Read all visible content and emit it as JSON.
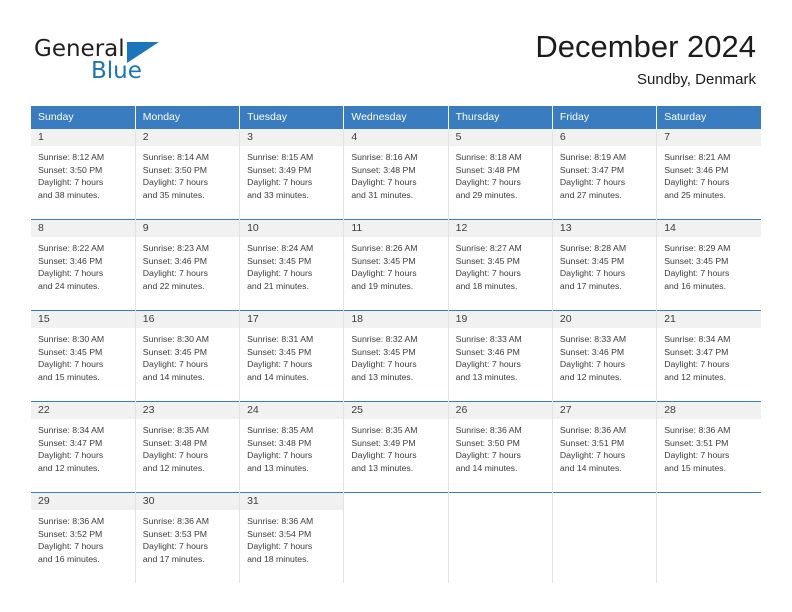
{
  "brand": {
    "name_part1": "General",
    "name_part2": "Blue",
    "triangle_icon": "triangle-icon",
    "accent_color": "#1b75bc"
  },
  "header": {
    "title": "December 2024",
    "subtitle": "Sundby, Denmark"
  },
  "colors": {
    "header_blue": "#3a7cc0",
    "daynum_bg": "#f1f1f1",
    "text": "#3c3c3c"
  },
  "weekday_headers": [
    "Sunday",
    "Monday",
    "Tuesday",
    "Wednesday",
    "Thursday",
    "Friday",
    "Saturday"
  ],
  "labels": {
    "sunrise_prefix": "Sunrise:",
    "sunset_prefix": "Sunset:",
    "daylight_prefix": "Daylight:"
  },
  "weeks": [
    [
      {
        "day": "1",
        "sunrise": "Sunrise: 8:12 AM",
        "sunset": "Sunset: 3:50 PM",
        "daylight1": "Daylight: 7 hours",
        "daylight2": "and 38 minutes."
      },
      {
        "day": "2",
        "sunrise": "Sunrise: 8:14 AM",
        "sunset": "Sunset: 3:50 PM",
        "daylight1": "Daylight: 7 hours",
        "daylight2": "and 35 minutes."
      },
      {
        "day": "3",
        "sunrise": "Sunrise: 8:15 AM",
        "sunset": "Sunset: 3:49 PM",
        "daylight1": "Daylight: 7 hours",
        "daylight2": "and 33 minutes."
      },
      {
        "day": "4",
        "sunrise": "Sunrise: 8:16 AM",
        "sunset": "Sunset: 3:48 PM",
        "daylight1": "Daylight: 7 hours",
        "daylight2": "and 31 minutes."
      },
      {
        "day": "5",
        "sunrise": "Sunrise: 8:18 AM",
        "sunset": "Sunset: 3:48 PM",
        "daylight1": "Daylight: 7 hours",
        "daylight2": "and 29 minutes."
      },
      {
        "day": "6",
        "sunrise": "Sunrise: 8:19 AM",
        "sunset": "Sunset: 3:47 PM",
        "daylight1": "Daylight: 7 hours",
        "daylight2": "and 27 minutes."
      },
      {
        "day": "7",
        "sunrise": "Sunrise: 8:21 AM",
        "sunset": "Sunset: 3:46 PM",
        "daylight1": "Daylight: 7 hours",
        "daylight2": "and 25 minutes."
      }
    ],
    [
      {
        "day": "8",
        "sunrise": "Sunrise: 8:22 AM",
        "sunset": "Sunset: 3:46 PM",
        "daylight1": "Daylight: 7 hours",
        "daylight2": "and 24 minutes."
      },
      {
        "day": "9",
        "sunrise": "Sunrise: 8:23 AM",
        "sunset": "Sunset: 3:46 PM",
        "daylight1": "Daylight: 7 hours",
        "daylight2": "and 22 minutes."
      },
      {
        "day": "10",
        "sunrise": "Sunrise: 8:24 AM",
        "sunset": "Sunset: 3:45 PM",
        "daylight1": "Daylight: 7 hours",
        "daylight2": "and 21 minutes."
      },
      {
        "day": "11",
        "sunrise": "Sunrise: 8:26 AM",
        "sunset": "Sunset: 3:45 PM",
        "daylight1": "Daylight: 7 hours",
        "daylight2": "and 19 minutes."
      },
      {
        "day": "12",
        "sunrise": "Sunrise: 8:27 AM",
        "sunset": "Sunset: 3:45 PM",
        "daylight1": "Daylight: 7 hours",
        "daylight2": "and 18 minutes."
      },
      {
        "day": "13",
        "sunrise": "Sunrise: 8:28 AM",
        "sunset": "Sunset: 3:45 PM",
        "daylight1": "Daylight: 7 hours",
        "daylight2": "and 17 minutes."
      },
      {
        "day": "14",
        "sunrise": "Sunrise: 8:29 AM",
        "sunset": "Sunset: 3:45 PM",
        "daylight1": "Daylight: 7 hours",
        "daylight2": "and 16 minutes."
      }
    ],
    [
      {
        "day": "15",
        "sunrise": "Sunrise: 8:30 AM",
        "sunset": "Sunset: 3:45 PM",
        "daylight1": "Daylight: 7 hours",
        "daylight2": "and 15 minutes."
      },
      {
        "day": "16",
        "sunrise": "Sunrise: 8:30 AM",
        "sunset": "Sunset: 3:45 PM",
        "daylight1": "Daylight: 7 hours",
        "daylight2": "and 14 minutes."
      },
      {
        "day": "17",
        "sunrise": "Sunrise: 8:31 AM",
        "sunset": "Sunset: 3:45 PM",
        "daylight1": "Daylight: 7 hours",
        "daylight2": "and 14 minutes."
      },
      {
        "day": "18",
        "sunrise": "Sunrise: 8:32 AM",
        "sunset": "Sunset: 3:45 PM",
        "daylight1": "Daylight: 7 hours",
        "daylight2": "and 13 minutes."
      },
      {
        "day": "19",
        "sunrise": "Sunrise: 8:33 AM",
        "sunset": "Sunset: 3:46 PM",
        "daylight1": "Daylight: 7 hours",
        "daylight2": "and 13 minutes."
      },
      {
        "day": "20",
        "sunrise": "Sunrise: 8:33 AM",
        "sunset": "Sunset: 3:46 PM",
        "daylight1": "Daylight: 7 hours",
        "daylight2": "and 12 minutes."
      },
      {
        "day": "21",
        "sunrise": "Sunrise: 8:34 AM",
        "sunset": "Sunset: 3:47 PM",
        "daylight1": "Daylight: 7 hours",
        "daylight2": "and 12 minutes."
      }
    ],
    [
      {
        "day": "22",
        "sunrise": "Sunrise: 8:34 AM",
        "sunset": "Sunset: 3:47 PM",
        "daylight1": "Daylight: 7 hours",
        "daylight2": "and 12 minutes."
      },
      {
        "day": "23",
        "sunrise": "Sunrise: 8:35 AM",
        "sunset": "Sunset: 3:48 PM",
        "daylight1": "Daylight: 7 hours",
        "daylight2": "and 12 minutes."
      },
      {
        "day": "24",
        "sunrise": "Sunrise: 8:35 AM",
        "sunset": "Sunset: 3:48 PM",
        "daylight1": "Daylight: 7 hours",
        "daylight2": "and 13 minutes."
      },
      {
        "day": "25",
        "sunrise": "Sunrise: 8:35 AM",
        "sunset": "Sunset: 3:49 PM",
        "daylight1": "Daylight: 7 hours",
        "daylight2": "and 13 minutes."
      },
      {
        "day": "26",
        "sunrise": "Sunrise: 8:36 AM",
        "sunset": "Sunset: 3:50 PM",
        "daylight1": "Daylight: 7 hours",
        "daylight2": "and 14 minutes."
      },
      {
        "day": "27",
        "sunrise": "Sunrise: 8:36 AM",
        "sunset": "Sunset: 3:51 PM",
        "daylight1": "Daylight: 7 hours",
        "daylight2": "and 14 minutes."
      },
      {
        "day": "28",
        "sunrise": "Sunrise: 8:36 AM",
        "sunset": "Sunset: 3:51 PM",
        "daylight1": "Daylight: 7 hours",
        "daylight2": "and 15 minutes."
      }
    ],
    [
      {
        "day": "29",
        "sunrise": "Sunrise: 8:36 AM",
        "sunset": "Sunset: 3:52 PM",
        "daylight1": "Daylight: 7 hours",
        "daylight2": "and 16 minutes."
      },
      {
        "day": "30",
        "sunrise": "Sunrise: 8:36 AM",
        "sunset": "Sunset: 3:53 PM",
        "daylight1": "Daylight: 7 hours",
        "daylight2": "and 17 minutes."
      },
      {
        "day": "31",
        "sunrise": "Sunrise: 8:36 AM",
        "sunset": "Sunset: 3:54 PM",
        "daylight1": "Daylight: 7 hours",
        "daylight2": "and 18 minutes."
      },
      {
        "day": "",
        "sunrise": "",
        "sunset": "",
        "daylight1": "",
        "daylight2": ""
      },
      {
        "day": "",
        "sunrise": "",
        "sunset": "",
        "daylight1": "",
        "daylight2": ""
      },
      {
        "day": "",
        "sunrise": "",
        "sunset": "",
        "daylight1": "",
        "daylight2": ""
      },
      {
        "day": "",
        "sunrise": "",
        "sunset": "",
        "daylight1": "",
        "daylight2": ""
      }
    ]
  ]
}
